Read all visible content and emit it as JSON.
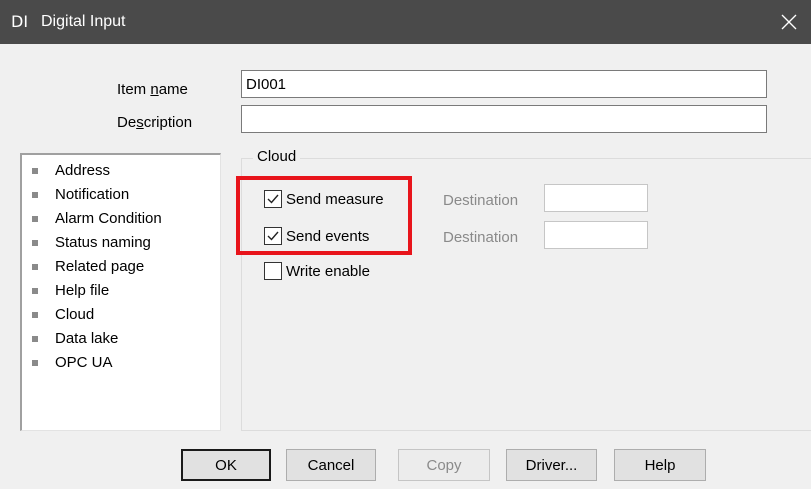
{
  "window": {
    "icon_text": "DI",
    "title": "Digital Input"
  },
  "fields": {
    "item_name": {
      "label_pre": "Item ",
      "label_mnemonic": "n",
      "label_post": "ame",
      "value": "DI001"
    },
    "description": {
      "label_pre": "De",
      "label_mnemonic": "s",
      "label_post": "cription",
      "value": ""
    }
  },
  "nav": {
    "items": [
      "Address",
      "Notification",
      "Alarm Condition",
      "Status naming",
      "Related page",
      "Help file",
      "Cloud",
      "Data lake",
      "OPC UA"
    ]
  },
  "cloud": {
    "group_title": "Cloud",
    "send_measure": {
      "label": "Send measure",
      "checked": true,
      "destination_label": "Destination",
      "destination_value": ""
    },
    "send_events": {
      "label": "Send events",
      "checked": true,
      "destination_label": "Destination",
      "destination_value": ""
    },
    "write_enable": {
      "label": "Write enable",
      "checked": false
    }
  },
  "buttons": {
    "ok": "OK",
    "cancel": "Cancel",
    "copy": "Copy",
    "driver": "Driver...",
    "help": "Help"
  },
  "colors": {
    "titlebar": "#4a4a4a",
    "highlight": "#e8141b"
  }
}
